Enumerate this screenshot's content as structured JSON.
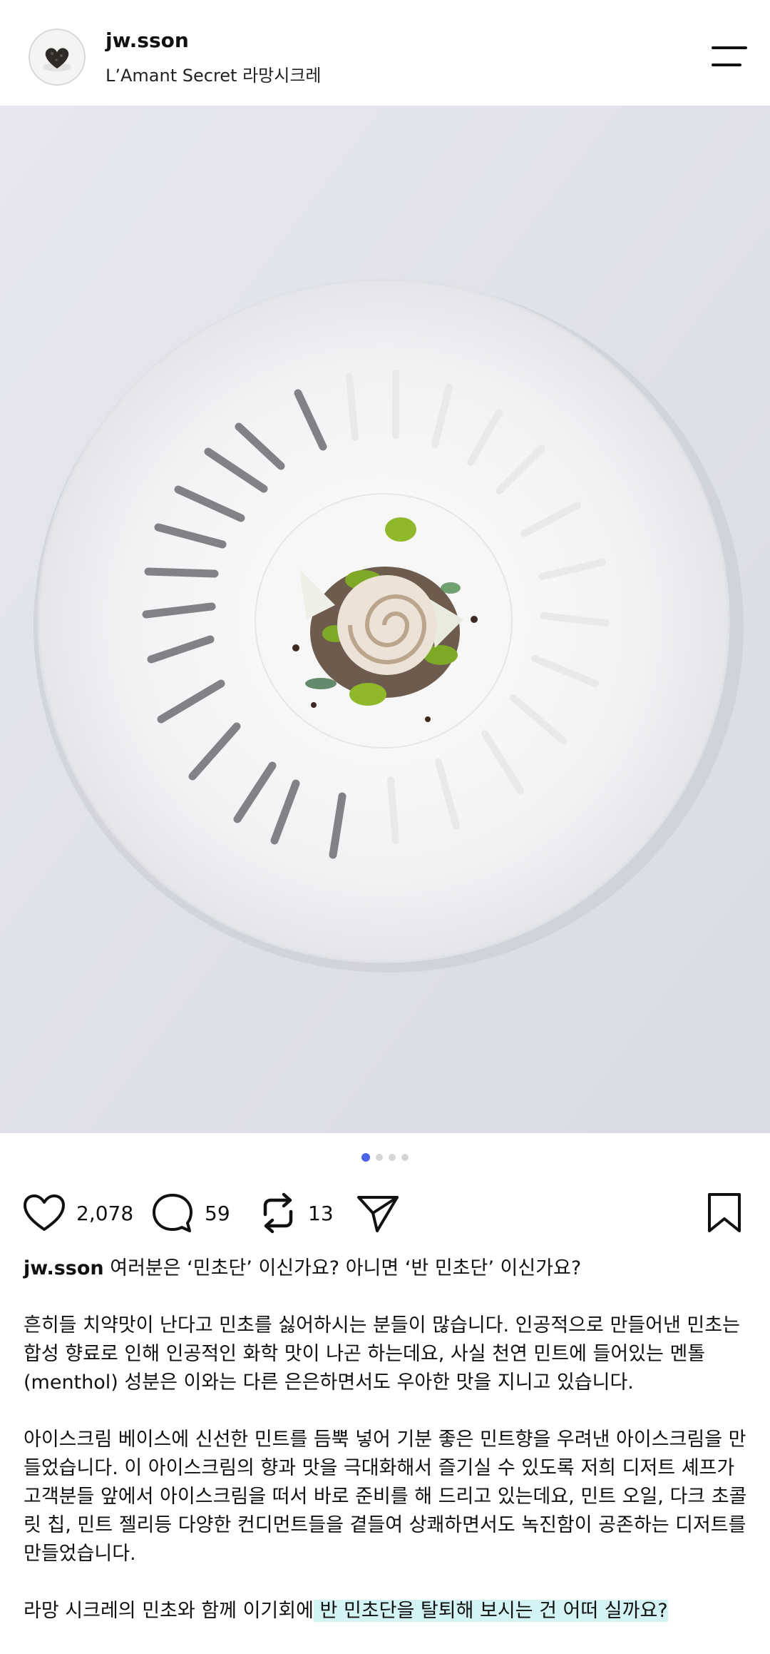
{
  "header": {
    "username": "jw.sson",
    "subtitle": "L’Amant Secret 라망시크레",
    "menu_icon": "hamburger-menu-icon"
  },
  "post": {
    "image_index": 1,
    "image_count": 4,
    "actions": {
      "like_count": "2,078",
      "comment_count": "59",
      "repost_count": "13",
      "icons": [
        "heart-icon",
        "comment-icon",
        "repost-icon",
        "send-icon",
        "bookmark-icon"
      ]
    },
    "caption": {
      "username": "jw.sson",
      "line1": "여러분은 ‘민초단’ 이신가요? 아니면 ‘반 민초단’ 이신가요?",
      "para2": "흔히들 치약맛이 난다고 민초를 싫어하시는 분들이 많습니다. 인공적으로 만들어낸 민초는 합성 향료로 인해 인공적인 화학 맛이 나곤 하는데요, 사실 천연 민트에 들어있는 멘톨(menthol) 성분은 이와는 다른 은은하면서도 우아한 맛을 지니고 있습니다.",
      "para3": "아이스크림 베이스에 신선한 민트를 듬뿍 넣어 기분 좋은 민트향을 우려낸 아이스크림을 만들었습니다. 이 아이스크림의 향과 맛을 극대화해서 즐기실 수 있도록 저희 디저트 셰프가 고객분들 앞에서 아이스크림을 떠서 바로 준비를 해 드리고 있는데요, 민트 오일, 다크 초콜릿 칩, 민트 젤리등 다양한 컨디먼트들을 곁들여 상쾌하면서도 녹진함이 공존하는 디저트를 만들었습니다.",
      "para4_plain": "라망 시크레의 민초와 함께 이기회에",
      "para4_highlight": " 반 민초단을 탈퇴해 보시는 건 어떠 실까요? "
    }
  },
  "colors": {
    "accent_dot": "#4d63e8",
    "highlight": "#d3f3f4"
  }
}
